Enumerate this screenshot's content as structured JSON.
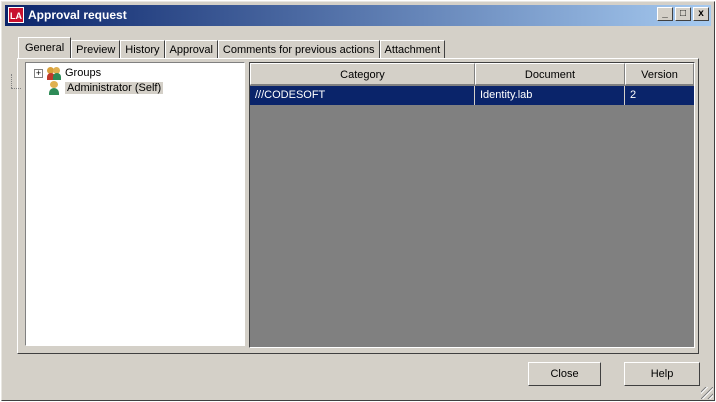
{
  "window": {
    "title": "Approval request",
    "icon_text": "LA",
    "caption_buttons": {
      "minimize": "_",
      "maximize": "□",
      "close": "x"
    }
  },
  "tabs": [
    {
      "label": "General",
      "active": true
    },
    {
      "label": "Preview",
      "active": false
    },
    {
      "label": "History",
      "active": false
    },
    {
      "label": "Approval",
      "active": false
    },
    {
      "label": "Comments for previous actions",
      "active": false
    },
    {
      "label": "Attachment",
      "active": false
    }
  ],
  "tree": {
    "nodes": [
      {
        "label": "Groups",
        "icon": "users-group-icon",
        "expander": "+"
      },
      {
        "label": "Administrator (Self)",
        "icon": "user-icon",
        "selected": true
      }
    ]
  },
  "grid": {
    "columns": [
      "Category",
      "Document",
      "Version"
    ],
    "rows": [
      {
        "category": "///CODESOFT",
        "document": "Identity.lab",
        "version": "2",
        "selected": true
      }
    ]
  },
  "buttons": {
    "close": "Close",
    "help": "Help"
  },
  "colors": {
    "titlebar_start": "#0a246a",
    "titlebar_end": "#a6caf0",
    "selection": "#0a246a",
    "face": "#d4d0c8"
  }
}
